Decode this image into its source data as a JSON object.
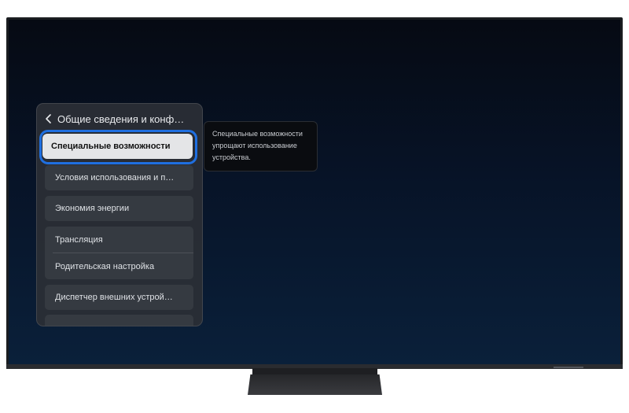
{
  "menu": {
    "title": "Общие сведения и конф…",
    "selected_item": "Специальные возможности",
    "items": [
      "Условия использования и п…",
      "Экономия энергии"
    ],
    "group_items": [
      "Трансляция",
      "Родительская настройка"
    ],
    "last_item": "Диспетчер внешних устрой…"
  },
  "tooltip": {
    "text": "Специальные возможности упрощают использование устройства."
  }
}
